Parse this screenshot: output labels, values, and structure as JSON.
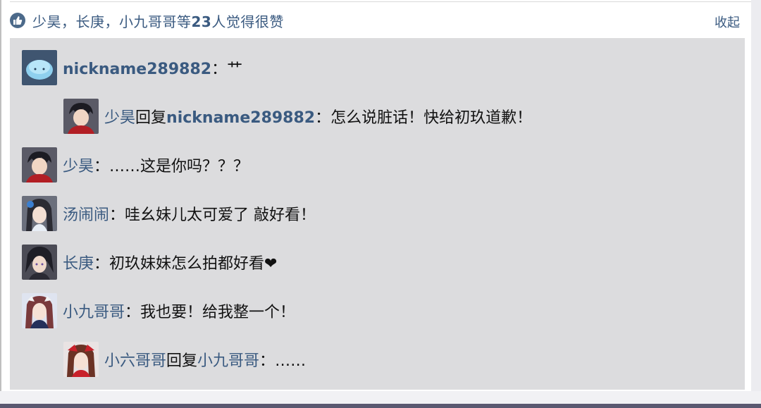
{
  "likes": {
    "prefix": "少昊，长庚，小九哥哥等",
    "count": "23",
    "suffix": "人觉得很赞",
    "collapse_label": "收起"
  },
  "comments": [
    {
      "user": "nickname289882",
      "separator": "：",
      "text": "艹"
    },
    {
      "user": "少昊",
      "reply_word": "回复",
      "reply_to": "nickname289882",
      "separator": "：",
      "text": "怎么说脏话！快给初玖道歉！"
    },
    {
      "user": "少昊",
      "separator": "：",
      "text": "……这是你吗？？？"
    },
    {
      "user": "汤闹闹",
      "separator": "：",
      "text": "哇幺妹儿太可爱了 敲好看！"
    },
    {
      "user": "长庚",
      "separator": "：",
      "text": "初玖妹妹怎么拍都好看❤"
    },
    {
      "user": "小九哥哥",
      "separator": "：",
      "text": "我也要！给我整一个！"
    },
    {
      "user": "小六哥哥",
      "reply_word": "回复",
      "reply_to": "小九哥哥",
      "separator": "：",
      "text": "……"
    }
  ],
  "colors": {
    "link": "#3a5a80",
    "panel": "#dcdcde"
  }
}
